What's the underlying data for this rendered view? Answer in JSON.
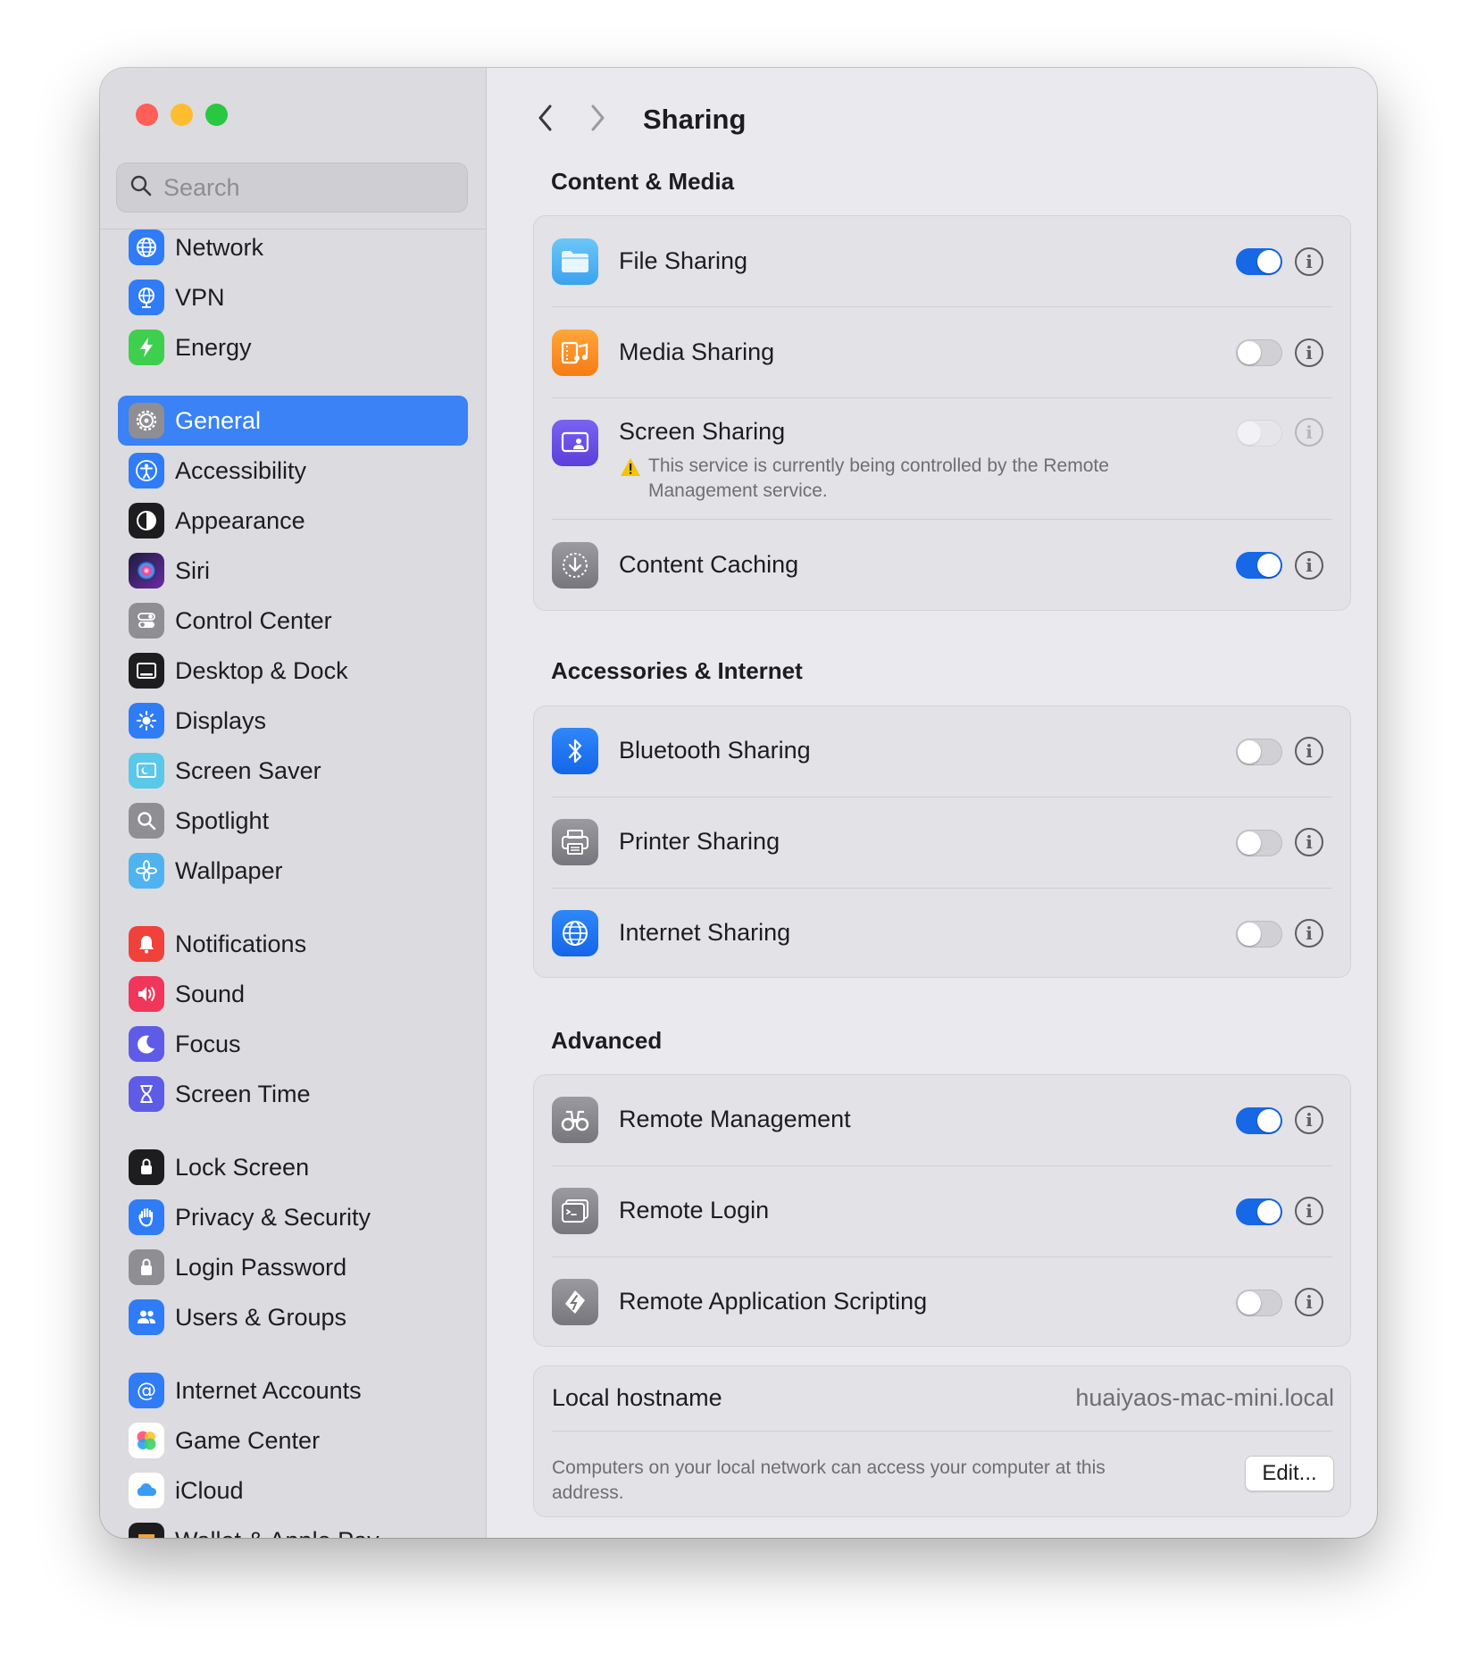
{
  "window": {
    "lights": {
      "close_color": "#ff5f57",
      "minimize_color": "#febc2e",
      "zoom_color": "#28c840"
    }
  },
  "sidebar": {
    "search_placeholder": "Search",
    "items": [
      {
        "label": "Network",
        "icon": "globe-icon",
        "color": "#2f7cf6"
      },
      {
        "label": "VPN",
        "icon": "vpn-globe-icon",
        "color": "#2f7cf6"
      },
      {
        "label": "Energy",
        "icon": "bolt-icon",
        "color": "#3fcf4e"
      },
      {
        "label": "General",
        "icon": "gear-icon",
        "color": "#8e8e93",
        "selected": true
      },
      {
        "label": "Accessibility",
        "icon": "accessibility-icon",
        "color": "#2f7cf6"
      },
      {
        "label": "Appearance",
        "icon": "appearance-icon",
        "color": "#1d1d1f"
      },
      {
        "label": "Siri",
        "icon": "siri-icon",
        "color": "#a13cc8"
      },
      {
        "label": "Control Center",
        "icon": "switches-icon",
        "color": "#8e8e93"
      },
      {
        "label": "Desktop & Dock",
        "icon": "dock-icon",
        "color": "#1d1d1f"
      },
      {
        "label": "Displays",
        "icon": "sun-icon",
        "color": "#2f7cf6"
      },
      {
        "label": "Screen Saver",
        "icon": "screen-saver-icon",
        "color": "#5ac8e8"
      },
      {
        "label": "Spotlight",
        "icon": "magnifier-icon",
        "color": "#8e8e93"
      },
      {
        "label": "Wallpaper",
        "icon": "flower-icon",
        "color": "#4fb3f0"
      },
      {
        "label": "Notifications",
        "icon": "bell-icon",
        "color": "#f0413a"
      },
      {
        "label": "Sound",
        "icon": "speaker-icon",
        "color": "#f0365a"
      },
      {
        "label": "Focus",
        "icon": "moon-icon",
        "color": "#5e5ce6"
      },
      {
        "label": "Screen Time",
        "icon": "hourglass-icon",
        "color": "#5e5ce6"
      },
      {
        "label": "Lock Screen",
        "icon": "lock-screen-icon",
        "color": "#1d1d1f"
      },
      {
        "label": "Privacy & Security",
        "icon": "hand-icon",
        "color": "#2f7cf6"
      },
      {
        "label": "Login Password",
        "icon": "lock-icon",
        "color": "#8e8e93"
      },
      {
        "label": "Users & Groups",
        "icon": "users-icon",
        "color": "#2f7cf6"
      },
      {
        "label": "Internet Accounts",
        "icon": "at-icon",
        "color": "#2f7cf6"
      },
      {
        "label": "Game Center",
        "icon": "game-center-icon",
        "color": "#ffffff"
      },
      {
        "label": "iCloud",
        "icon": "cloud-icon",
        "color": "#ffffff"
      },
      {
        "label": "Wallet & Apple Pay",
        "icon": "wallet-icon",
        "color": "#1d1d1f"
      }
    ]
  },
  "header": {
    "back": "back-chevron-icon",
    "forward": "forward-chevron-icon",
    "title": "Sharing"
  },
  "sections": {
    "content_media": {
      "title": "Content & Media",
      "rows": [
        {
          "label": "File Sharing",
          "on": true,
          "icon": "folder-icon"
        },
        {
          "label": "Media Sharing",
          "on": false,
          "icon": "media-icon"
        },
        {
          "label": "Screen Sharing",
          "on": false,
          "disabled": true,
          "icon": "screen-sharing-icon",
          "note": "This service is currently being controlled by the Remote Management service."
        },
        {
          "label": "Content Caching",
          "on": true,
          "icon": "content-caching-icon"
        }
      ]
    },
    "accessories_internet": {
      "title": "Accessories & Internet",
      "rows": [
        {
          "label": "Bluetooth Sharing",
          "on": false,
          "icon": "bluetooth-icon"
        },
        {
          "label": "Printer Sharing",
          "on": false,
          "icon": "printer-icon"
        },
        {
          "label": "Internet Sharing",
          "on": false,
          "icon": "internet-globe-icon"
        }
      ]
    },
    "advanced": {
      "title": "Advanced",
      "rows": [
        {
          "label": "Remote Management",
          "on": true,
          "icon": "binoculars-icon"
        },
        {
          "label": "Remote Login",
          "on": true,
          "icon": "terminal-icon"
        },
        {
          "label": "Remote Application Scripting",
          "on": false,
          "icon": "script-icon"
        }
      ]
    }
  },
  "hostname": {
    "label": "Local hostname",
    "value": "huaiyaos-mac-mini.local",
    "description": "Computers on your local network can access your computer at this address.",
    "edit_label": "Edit..."
  },
  "info_glyph": "i"
}
